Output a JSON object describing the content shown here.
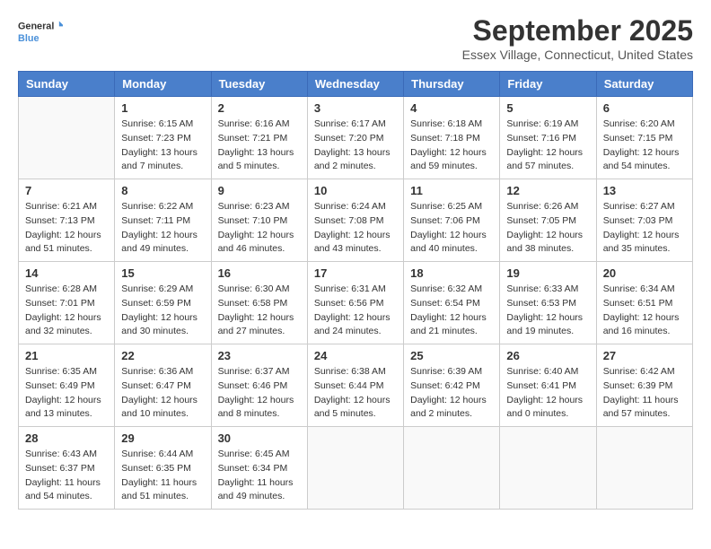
{
  "logo": {
    "general": "General",
    "blue": "Blue"
  },
  "header": {
    "month": "September 2025",
    "location": "Essex Village, Connecticut, United States"
  },
  "weekdays": [
    "Sunday",
    "Monday",
    "Tuesday",
    "Wednesday",
    "Thursday",
    "Friday",
    "Saturday"
  ],
  "weeks": [
    [
      {
        "day": "",
        "sunrise": "",
        "sunset": "",
        "daylight": ""
      },
      {
        "day": "1",
        "sunrise": "Sunrise: 6:15 AM",
        "sunset": "Sunset: 7:23 PM",
        "daylight": "Daylight: 13 hours and 7 minutes."
      },
      {
        "day": "2",
        "sunrise": "Sunrise: 6:16 AM",
        "sunset": "Sunset: 7:21 PM",
        "daylight": "Daylight: 13 hours and 5 minutes."
      },
      {
        "day": "3",
        "sunrise": "Sunrise: 6:17 AM",
        "sunset": "Sunset: 7:20 PM",
        "daylight": "Daylight: 13 hours and 2 minutes."
      },
      {
        "day": "4",
        "sunrise": "Sunrise: 6:18 AM",
        "sunset": "Sunset: 7:18 PM",
        "daylight": "Daylight: 12 hours and 59 minutes."
      },
      {
        "day": "5",
        "sunrise": "Sunrise: 6:19 AM",
        "sunset": "Sunset: 7:16 PM",
        "daylight": "Daylight: 12 hours and 57 minutes."
      },
      {
        "day": "6",
        "sunrise": "Sunrise: 6:20 AM",
        "sunset": "Sunset: 7:15 PM",
        "daylight": "Daylight: 12 hours and 54 minutes."
      }
    ],
    [
      {
        "day": "7",
        "sunrise": "Sunrise: 6:21 AM",
        "sunset": "Sunset: 7:13 PM",
        "daylight": "Daylight: 12 hours and 51 minutes."
      },
      {
        "day": "8",
        "sunrise": "Sunrise: 6:22 AM",
        "sunset": "Sunset: 7:11 PM",
        "daylight": "Daylight: 12 hours and 49 minutes."
      },
      {
        "day": "9",
        "sunrise": "Sunrise: 6:23 AM",
        "sunset": "Sunset: 7:10 PM",
        "daylight": "Daylight: 12 hours and 46 minutes."
      },
      {
        "day": "10",
        "sunrise": "Sunrise: 6:24 AM",
        "sunset": "Sunset: 7:08 PM",
        "daylight": "Daylight: 12 hours and 43 minutes."
      },
      {
        "day": "11",
        "sunrise": "Sunrise: 6:25 AM",
        "sunset": "Sunset: 7:06 PM",
        "daylight": "Daylight: 12 hours and 40 minutes."
      },
      {
        "day": "12",
        "sunrise": "Sunrise: 6:26 AM",
        "sunset": "Sunset: 7:05 PM",
        "daylight": "Daylight: 12 hours and 38 minutes."
      },
      {
        "day": "13",
        "sunrise": "Sunrise: 6:27 AM",
        "sunset": "Sunset: 7:03 PM",
        "daylight": "Daylight: 12 hours and 35 minutes."
      }
    ],
    [
      {
        "day": "14",
        "sunrise": "Sunrise: 6:28 AM",
        "sunset": "Sunset: 7:01 PM",
        "daylight": "Daylight: 12 hours and 32 minutes."
      },
      {
        "day": "15",
        "sunrise": "Sunrise: 6:29 AM",
        "sunset": "Sunset: 6:59 PM",
        "daylight": "Daylight: 12 hours and 30 minutes."
      },
      {
        "day": "16",
        "sunrise": "Sunrise: 6:30 AM",
        "sunset": "Sunset: 6:58 PM",
        "daylight": "Daylight: 12 hours and 27 minutes."
      },
      {
        "day": "17",
        "sunrise": "Sunrise: 6:31 AM",
        "sunset": "Sunset: 6:56 PM",
        "daylight": "Daylight: 12 hours and 24 minutes."
      },
      {
        "day": "18",
        "sunrise": "Sunrise: 6:32 AM",
        "sunset": "Sunset: 6:54 PM",
        "daylight": "Daylight: 12 hours and 21 minutes."
      },
      {
        "day": "19",
        "sunrise": "Sunrise: 6:33 AM",
        "sunset": "Sunset: 6:53 PM",
        "daylight": "Daylight: 12 hours and 19 minutes."
      },
      {
        "day": "20",
        "sunrise": "Sunrise: 6:34 AM",
        "sunset": "Sunset: 6:51 PM",
        "daylight": "Daylight: 12 hours and 16 minutes."
      }
    ],
    [
      {
        "day": "21",
        "sunrise": "Sunrise: 6:35 AM",
        "sunset": "Sunset: 6:49 PM",
        "daylight": "Daylight: 12 hours and 13 minutes."
      },
      {
        "day": "22",
        "sunrise": "Sunrise: 6:36 AM",
        "sunset": "Sunset: 6:47 PM",
        "daylight": "Daylight: 12 hours and 10 minutes."
      },
      {
        "day": "23",
        "sunrise": "Sunrise: 6:37 AM",
        "sunset": "Sunset: 6:46 PM",
        "daylight": "Daylight: 12 hours and 8 minutes."
      },
      {
        "day": "24",
        "sunrise": "Sunrise: 6:38 AM",
        "sunset": "Sunset: 6:44 PM",
        "daylight": "Daylight: 12 hours and 5 minutes."
      },
      {
        "day": "25",
        "sunrise": "Sunrise: 6:39 AM",
        "sunset": "Sunset: 6:42 PM",
        "daylight": "Daylight: 12 hours and 2 minutes."
      },
      {
        "day": "26",
        "sunrise": "Sunrise: 6:40 AM",
        "sunset": "Sunset: 6:41 PM",
        "daylight": "Daylight: 12 hours and 0 minutes."
      },
      {
        "day": "27",
        "sunrise": "Sunrise: 6:42 AM",
        "sunset": "Sunset: 6:39 PM",
        "daylight": "Daylight: 11 hours and 57 minutes."
      }
    ],
    [
      {
        "day": "28",
        "sunrise": "Sunrise: 6:43 AM",
        "sunset": "Sunset: 6:37 PM",
        "daylight": "Daylight: 11 hours and 54 minutes."
      },
      {
        "day": "29",
        "sunrise": "Sunrise: 6:44 AM",
        "sunset": "Sunset: 6:35 PM",
        "daylight": "Daylight: 11 hours and 51 minutes."
      },
      {
        "day": "30",
        "sunrise": "Sunrise: 6:45 AM",
        "sunset": "Sunset: 6:34 PM",
        "daylight": "Daylight: 11 hours and 49 minutes."
      },
      {
        "day": "",
        "sunrise": "",
        "sunset": "",
        "daylight": ""
      },
      {
        "day": "",
        "sunrise": "",
        "sunset": "",
        "daylight": ""
      },
      {
        "day": "",
        "sunrise": "",
        "sunset": "",
        "daylight": ""
      },
      {
        "day": "",
        "sunrise": "",
        "sunset": "",
        "daylight": ""
      }
    ]
  ]
}
